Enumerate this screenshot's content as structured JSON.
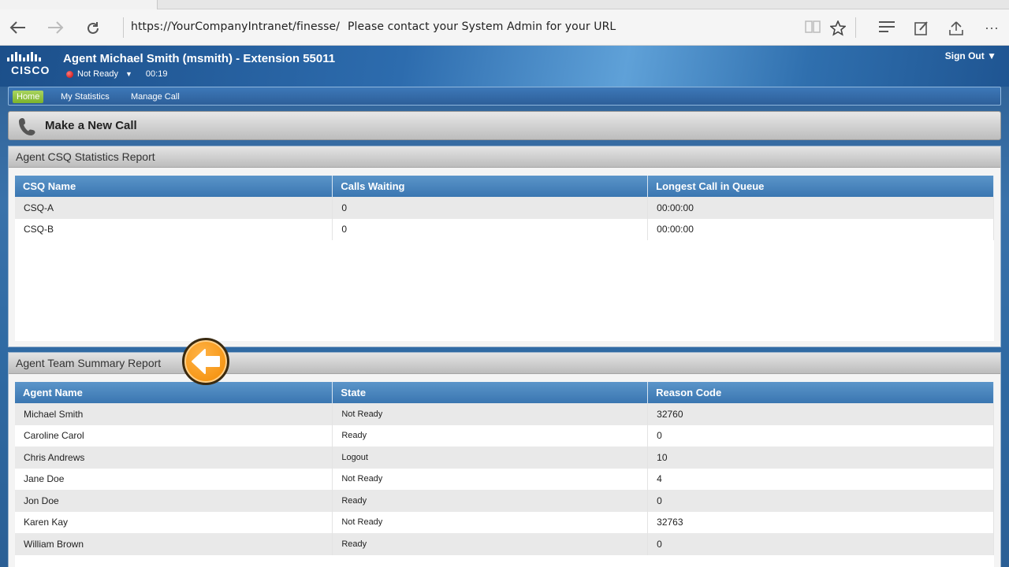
{
  "browser": {
    "url": "https://YourCompanyIntranet/finesse/",
    "url_note": "Please contact your System Admin for your URL",
    "icons": [
      "back-icon",
      "forward-icon",
      "refresh-icon",
      "reading-view-icon",
      "favorite-star-icon",
      "hub-icon",
      "web-note-icon",
      "share-icon",
      "more-icon"
    ]
  },
  "header": {
    "logo_text": "CISCO",
    "agent_title": "Agent Michael Smith (msmith) - Extension 55011",
    "status": "Not Ready",
    "timer": "00:19",
    "sign_out": "Sign Out"
  },
  "nav": {
    "home": "Home",
    "my_statistics": "My Statistics",
    "manage_call": "Manage Call"
  },
  "new_call": {
    "label": "Make a New Call"
  },
  "csq_report": {
    "title": "Agent CSQ Statistics Report",
    "headers": [
      "CSQ Name",
      "Calls Waiting",
      "Longest Call in Queue"
    ],
    "rows": [
      [
        "CSQ-A",
        "0",
        "00:00:00"
      ],
      [
        "CSQ-B",
        "0",
        "00:00:00"
      ]
    ]
  },
  "team_report": {
    "title": "Agent Team Summary Report",
    "headers": [
      "Agent Name",
      "State",
      "Reason Code"
    ],
    "rows": [
      [
        "Michael Smith",
        "Not Ready",
        "32760"
      ],
      [
        "Caroline Carol",
        "Ready",
        "0"
      ],
      [
        "Chris Andrews",
        "Logout",
        "10"
      ],
      [
        "Jane Doe",
        "Not Ready",
        "4"
      ],
      [
        "Jon Doe",
        "Ready",
        "0"
      ],
      [
        "Karen Kay",
        "Not Ready",
        "32763"
      ],
      [
        "William Brown",
        "Ready",
        "0"
      ]
    ]
  },
  "colors": {
    "header_blue": "#2d6cae",
    "table_header_blue": "#4a86be",
    "nav_active_green": "#8fc23a",
    "status_red": "#d00000",
    "callout_orange": "#f7941d"
  }
}
